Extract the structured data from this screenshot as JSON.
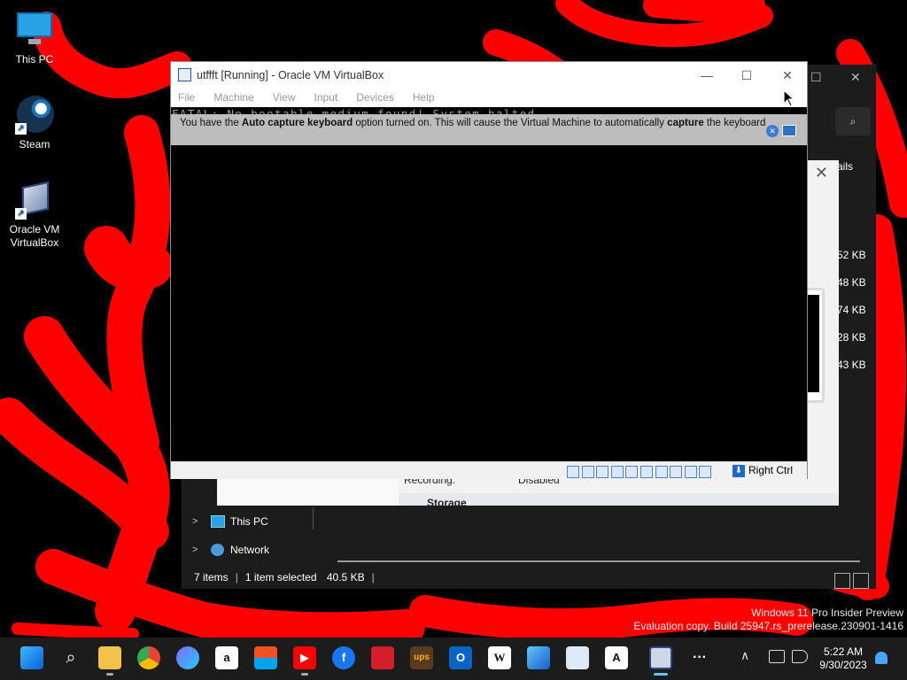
{
  "desktop": {
    "icons": [
      {
        "label": "This PC"
      },
      {
        "label": "Steam"
      },
      {
        "label": "Oracle VM VirtualBox"
      }
    ]
  },
  "explorer": {
    "details_tab": "ails",
    "file_sizes": [
      "52 KB",
      "48 KB",
      "74 KB",
      "28 KB",
      "43 KB"
    ],
    "nav": [
      {
        "label": "This PC"
      },
      {
        "label": "Network"
      }
    ],
    "status": {
      "items": "7 items",
      "selected": "1 item selected",
      "size": "40.5 KB"
    }
  },
  "settings_dialog": {
    "recording_label": "Recording:",
    "recording_value": "Disabled",
    "storage_header": "Storage"
  },
  "virtualbox": {
    "title": "utffft [Running] - Oracle VM VirtualBox",
    "menu": [
      "File",
      "Machine",
      "View",
      "Input",
      "Devices",
      "Help"
    ],
    "console_text": "FATAL: No bootable medium found! System halted.",
    "notice": {
      "part1": "You have the ",
      "bold1": "Auto capture keyboard",
      "part2": " option turned on. This will cause the Virtual Machine to automatically ",
      "bold2": "capture",
      "part3": " the keyboard"
    },
    "host_key": "Right Ctrl"
  },
  "watermark": {
    "line1": "Windows 11 Pro Insider Preview",
    "line2": "Evaluation copy. Build 25947.rs_prerelease.230901-1416"
  },
  "taskbar": {
    "apps": [
      "start",
      "search",
      "file-explorer",
      "chrome",
      "copilot",
      "amazon",
      "microsoft-store",
      "youtube",
      "facebook",
      "bank-of-america",
      "ups",
      "outlook",
      "wikipedia",
      "photos",
      "stock-chart",
      "adobe",
      "virtualbox"
    ],
    "time": "5:22 AM",
    "date": "9/30/2023"
  },
  "colors": {
    "scribble": "#ff0000",
    "taskbar": "#1c1c1c",
    "accent": "#0078d4"
  }
}
